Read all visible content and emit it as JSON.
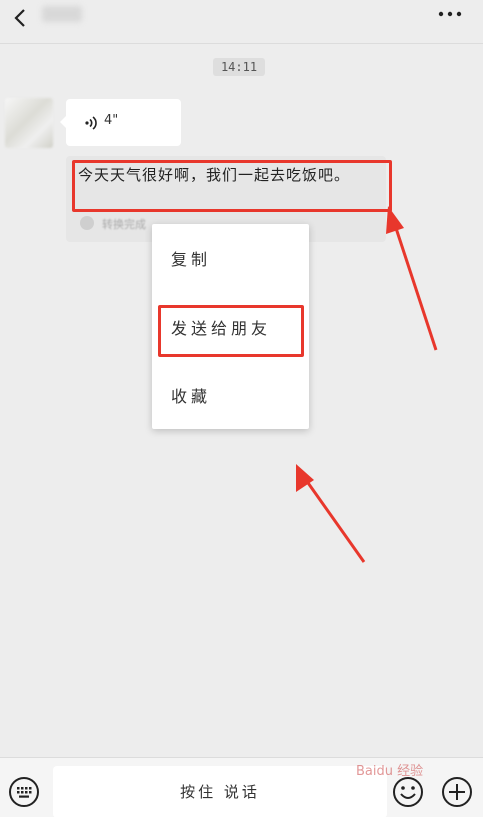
{
  "header": {
    "back_icon": "chevron-left-icon",
    "title": "",
    "more_icon": "more-dots-icon"
  },
  "chat": {
    "timestamp": "14:11",
    "voice_message": {
      "duration": "4\"",
      "icon": "voice-wave-icon"
    },
    "transcript": {
      "text": "今天天气很好啊，我们一起去吃饭吧。",
      "status_label": "转换完成"
    }
  },
  "context_menu": {
    "items": [
      {
        "label": "复制"
      },
      {
        "label": "发送给朋友"
      },
      {
        "label": "收藏"
      }
    ]
  },
  "bottom_bar": {
    "keyboard_icon": "keyboard-icon",
    "hold_to_talk": "按住 说话",
    "emoji_icon": "emoji-icon",
    "plus_icon": "plus-icon"
  },
  "watermark": "Baidu 经验",
  "annotation_color": "#e8372c"
}
